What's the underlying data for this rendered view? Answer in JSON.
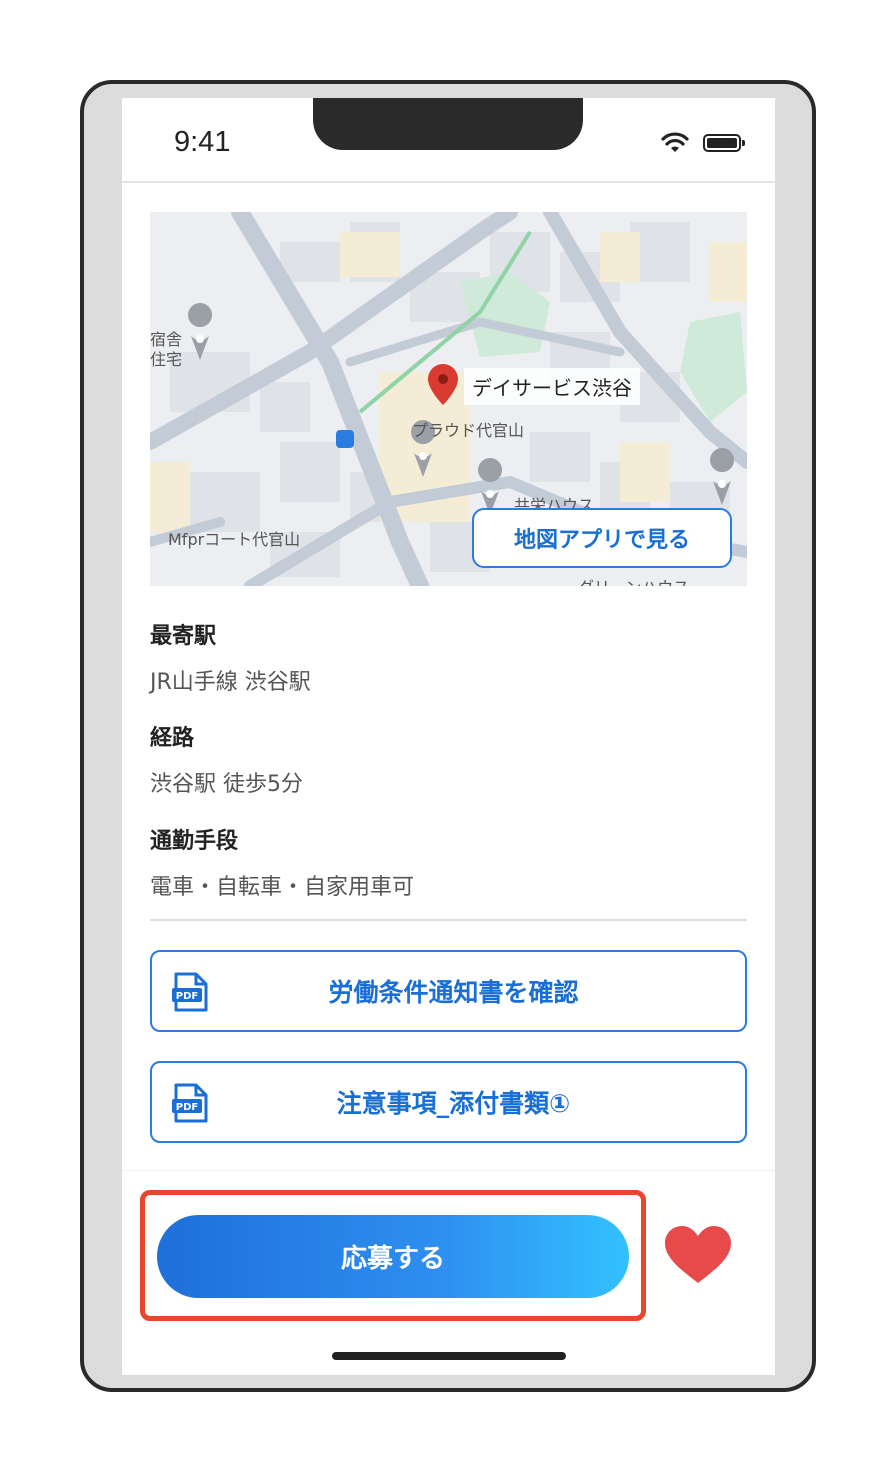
{
  "status_bar": {
    "time": "9:41",
    "icons": [
      "wifi-icon",
      "battery-icon"
    ]
  },
  "map": {
    "place_name": "デイサービス渋谷",
    "labels": [
      "宿舎",
      "住宅",
      "プラウド代官山",
      "共栄ハウス",
      "Mfprコート代官山",
      "グリーンハウス"
    ],
    "open_button": "地図アプリで見る"
  },
  "access": {
    "nearest_station_label": "最寄駅",
    "nearest_station_value": "JR山手線 渋谷駅",
    "route_label": "経路",
    "route_value": "渋谷駅 徒歩5分",
    "commute_label": "通勤手段",
    "commute_value": "電車・自転車・自家用車可"
  },
  "documents": [
    {
      "label": "労働条件通知書を確認",
      "icon": "pdf-icon"
    },
    {
      "label": "注意事項_添付書類①",
      "icon": "pdf-icon"
    }
  ],
  "actions": {
    "apply_button": "応募する",
    "favorite_icon": "heart-icon"
  },
  "colors": {
    "accent": "#1a6fd6",
    "highlight": "#e7472b",
    "heart": "#e84a4a",
    "pin": "#d93b30"
  }
}
